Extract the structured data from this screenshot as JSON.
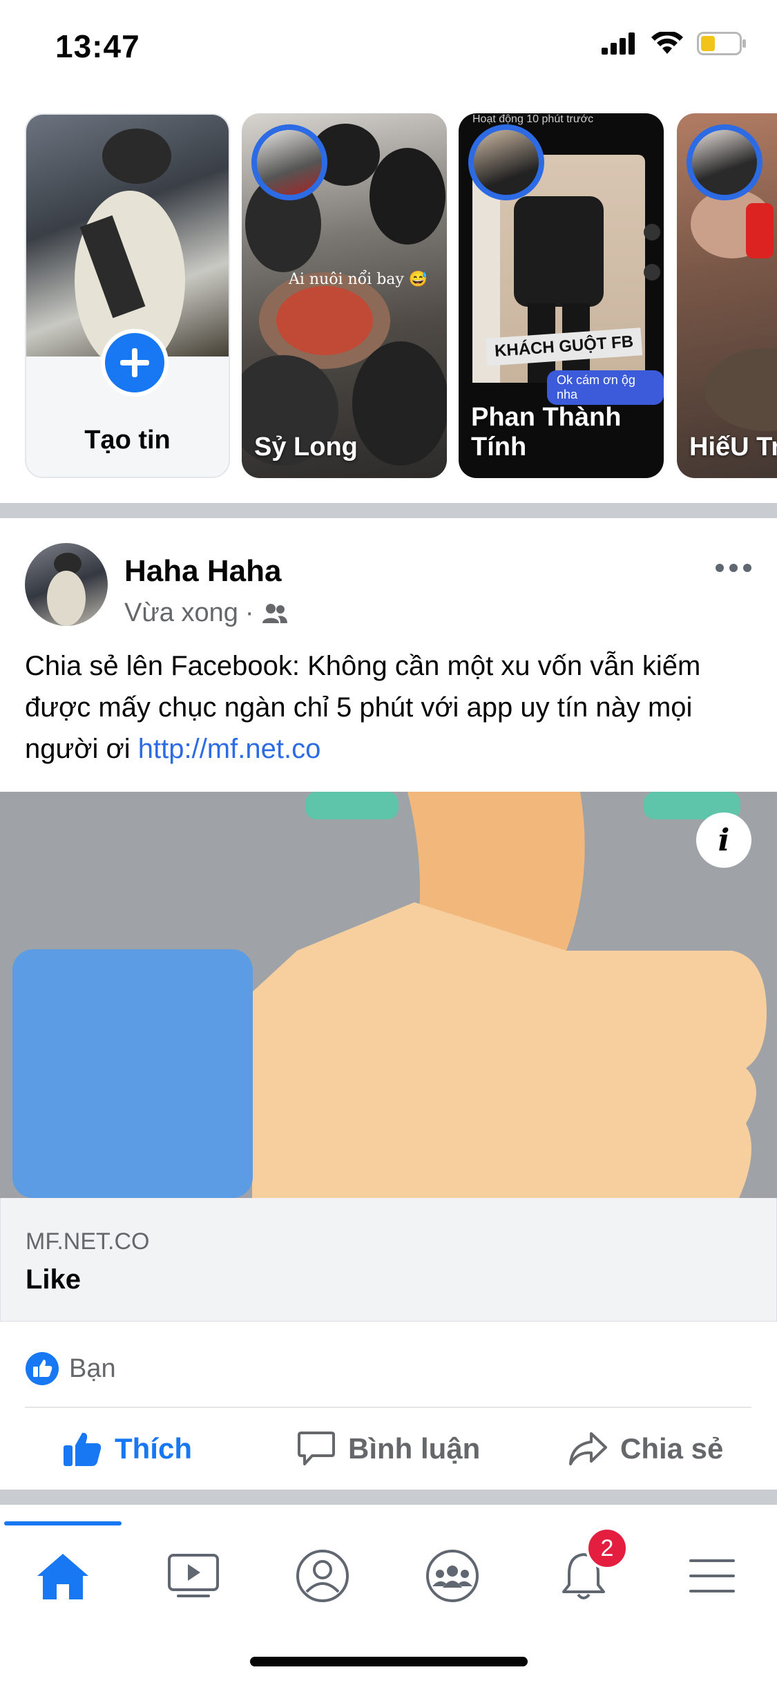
{
  "status_bar": {
    "time": "13:47"
  },
  "stories": {
    "create_label": "Tạo tin",
    "items": [
      {
        "name": "Sỷ Long",
        "caption": "Ai nuôi nổi bay 😅"
      },
      {
        "name": "Phan Thành Tính",
        "sticker": "KHÁCH GUỘT FB",
        "message": "Ok cám ơn ộg nha",
        "top_text": "Hoạt động 10 phút trước"
      },
      {
        "name": "HiếU Tr"
      }
    ]
  },
  "post": {
    "author": "Haha Haha",
    "time": "Vừa xong",
    "text": "Chia sẻ lên Facebook: Không cần một xu vốn vẫn kiếm được mấy chục ngàn chỉ 5 phút với app uy tín này mọi người ơi",
    "link_text": "http://mf.net.co",
    "link_domain": "MF.NET.CO",
    "link_title": "Like",
    "info_icon": "i",
    "reactions_text": "Bạn",
    "actions": {
      "like": "Thích",
      "comment": "Bình luận",
      "share": "Chia sẻ"
    }
  },
  "tabbar": {
    "icons": [
      "home-icon",
      "watch-icon",
      "profile-icon",
      "groups-icon",
      "notifications-icon",
      "menu-icon"
    ],
    "notifications_badge": "2"
  },
  "colors": {
    "accent": "#1877f2",
    "secondary_text": "#65676b",
    "badge": "#e41e3f"
  }
}
